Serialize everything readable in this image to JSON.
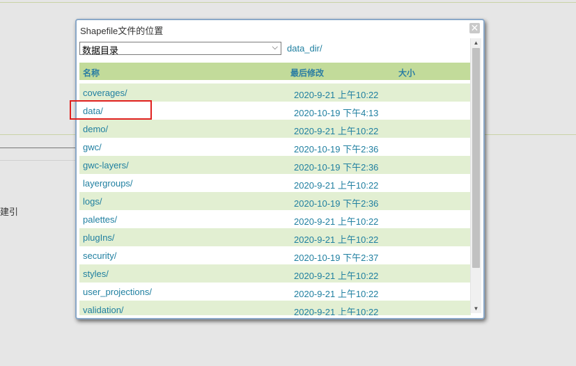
{
  "background": {
    "side_text": "建引"
  },
  "dialog": {
    "title": "Shapefile文件的位置",
    "close_symbol": "✕",
    "root_select_value": "数据目录",
    "current_path": "data_dir/",
    "columns": {
      "name": "名称",
      "modified": "最后修改",
      "size": "大小"
    },
    "rows": [
      {
        "name": "coverages/",
        "modified": "2020-9-21 上午10:22"
      },
      {
        "name": "data/",
        "modified": "2020-10-19 下午4:13"
      },
      {
        "name": "demo/",
        "modified": "2020-9-21 上午10:22"
      },
      {
        "name": "gwc/",
        "modified": "2020-10-19 下午2:36"
      },
      {
        "name": "gwc-layers/",
        "modified": "2020-10-19 下午2:36"
      },
      {
        "name": "layergroups/",
        "modified": "2020-9-21 上午10:22"
      },
      {
        "name": "logs/",
        "modified": "2020-10-19 下午2:36"
      },
      {
        "name": "palettes/",
        "modified": "2020-9-21 上午10:22"
      },
      {
        "name": "plugIns/",
        "modified": "2020-9-21 上午10:22"
      },
      {
        "name": "security/",
        "modified": "2020-10-19 下午2:37"
      },
      {
        "name": "styles/",
        "modified": "2020-9-21 上午10:22"
      },
      {
        "name": "user_projections/",
        "modified": "2020-9-21 上午10:22"
      },
      {
        "name": "validation/",
        "modified": "2020-9-21 上午10:22"
      }
    ]
  },
  "colors": {
    "header_bg": "#c2db9a",
    "row_alt_bg": "#e2efd2",
    "link": "#1f7fa0",
    "highlight": "#e0201e"
  },
  "icons": {
    "close": "close-icon",
    "dropdown": "chevron-down-icon",
    "scroll_up": "arrow-up-icon",
    "scroll_down": "arrow-down-icon"
  }
}
